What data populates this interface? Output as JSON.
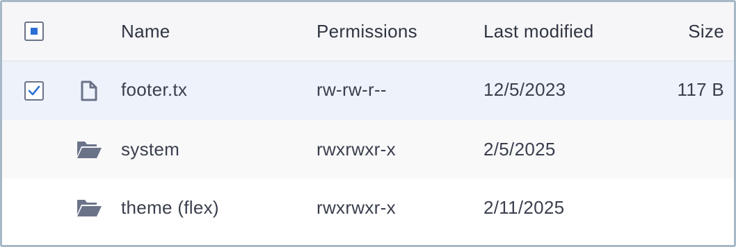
{
  "header": {
    "select_all_state": "indeterminate",
    "columns": {
      "name": "Name",
      "permissions": "Permissions",
      "last_modified": "Last modified",
      "size": "Size"
    }
  },
  "rows": [
    {
      "type": "file",
      "icon": "file-icon",
      "selected": true,
      "name": "footer.tx",
      "permissions": "rw-rw-r--",
      "last_modified": "12/5/2023",
      "size": "117 B"
    },
    {
      "type": "folder",
      "icon": "folder-open-icon",
      "selected": false,
      "name": "system",
      "permissions": "rwxrwxr-x",
      "last_modified": "2/5/2025",
      "size": ""
    },
    {
      "type": "folder",
      "icon": "folder-open-icon",
      "selected": false,
      "name": "theme (flex)",
      "permissions": "rwxrwxr-x",
      "last_modified": "2/11/2025",
      "size": ""
    }
  ],
  "colors": {
    "accent": "#2d6fd4",
    "selected_row": "#eef3fb",
    "header_bg": "#f6f6f8",
    "frame_border": "#a7b9c6",
    "icon": "#6b7389"
  }
}
